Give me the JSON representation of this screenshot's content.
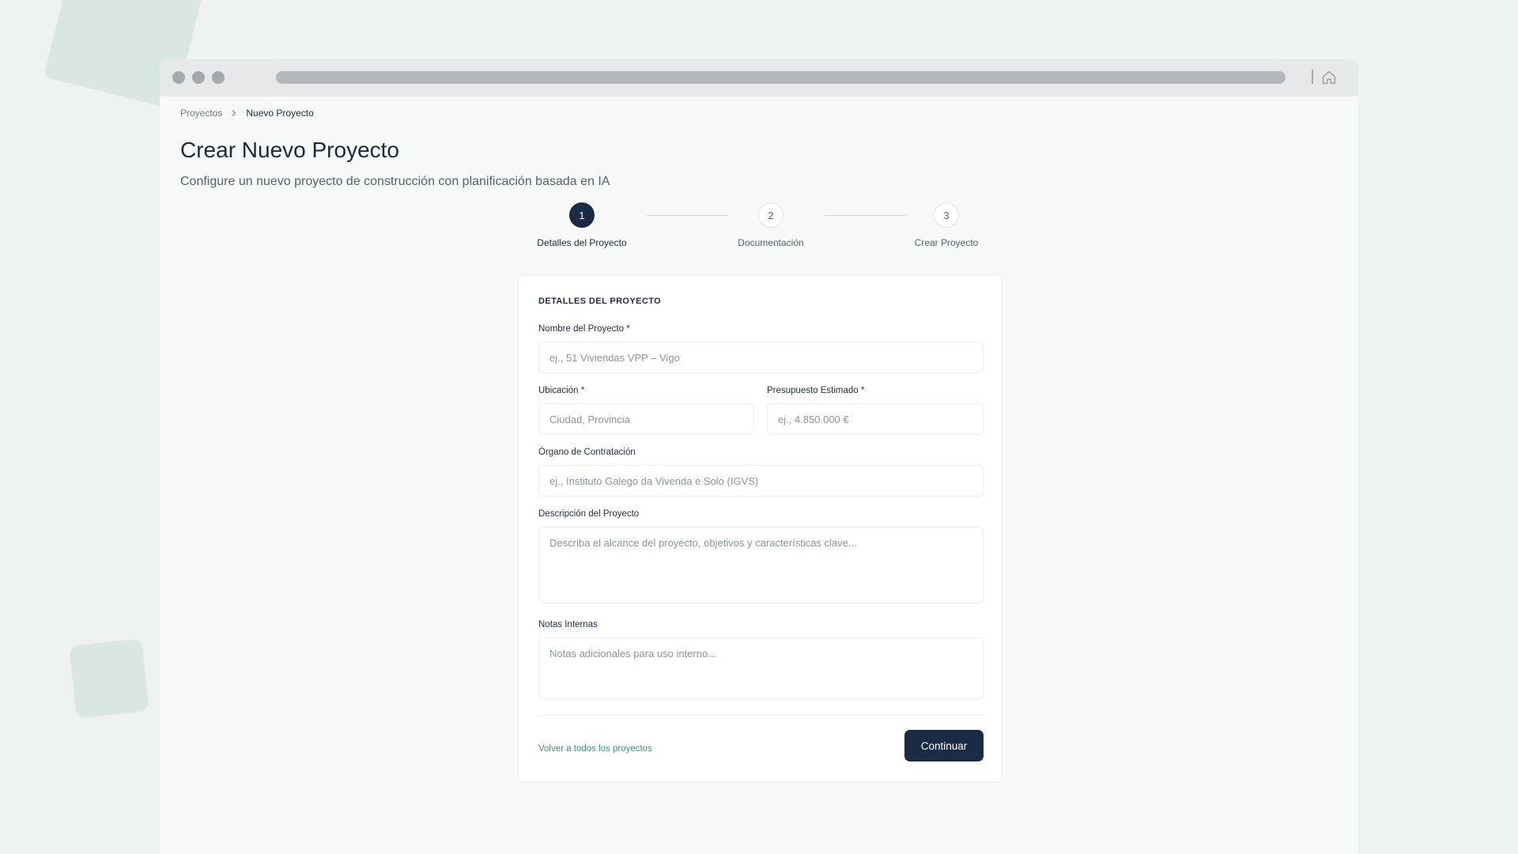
{
  "breadcrumb": {
    "parent": "Proyectos",
    "current": "Nuevo Proyecto"
  },
  "header": {
    "title": "Crear Nuevo Proyecto",
    "subtitle": "Configure un nuevo proyecto de construcción con planificación basada en IA"
  },
  "stepper": {
    "current_step": 1,
    "steps": [
      {
        "number": "1",
        "label": "Detalles del Proyecto"
      },
      {
        "number": "2",
        "label": "Documentación"
      },
      {
        "number": "3",
        "label": "Crear Proyecto"
      }
    ]
  },
  "form": {
    "section_title": "DETALLES DEL PROYECTO",
    "project_name": {
      "label": "Nombre del Proyecto *",
      "placeholder": "ej., 51 Viviendas VPP – Vigo",
      "value": ""
    },
    "location": {
      "label": "Ubicación *",
      "placeholder": "Ciudad, Provincia",
      "value": ""
    },
    "budget": {
      "label": "Presupuesto Estimado *",
      "placeholder": "ej., 4.850.000 €",
      "value": ""
    },
    "contracting_body": {
      "label": "Órgano de Contratación",
      "placeholder": "ej., Instituto Galego da Vivenda e Solo (IGVS)",
      "value": ""
    },
    "description": {
      "label": "Descripción del Proyecto",
      "placeholder": "Describa el alcance del proyecto, objetivos y características clave...",
      "value": ""
    },
    "internal_notes": {
      "label": "Notas Internas",
      "placeholder": "Notas adicionales para uso interno...",
      "value": ""
    },
    "back_link": "Volver a todos los proyectos",
    "continue_label": "Continuar"
  },
  "help": {
    "label": "?"
  },
  "icons": {
    "home": "home-icon",
    "breadcrumb_separator": "chevron-right-icon"
  },
  "colors": {
    "primary": "#1c2b44",
    "link": "#3d8f7e",
    "background": "#edf1ef"
  }
}
